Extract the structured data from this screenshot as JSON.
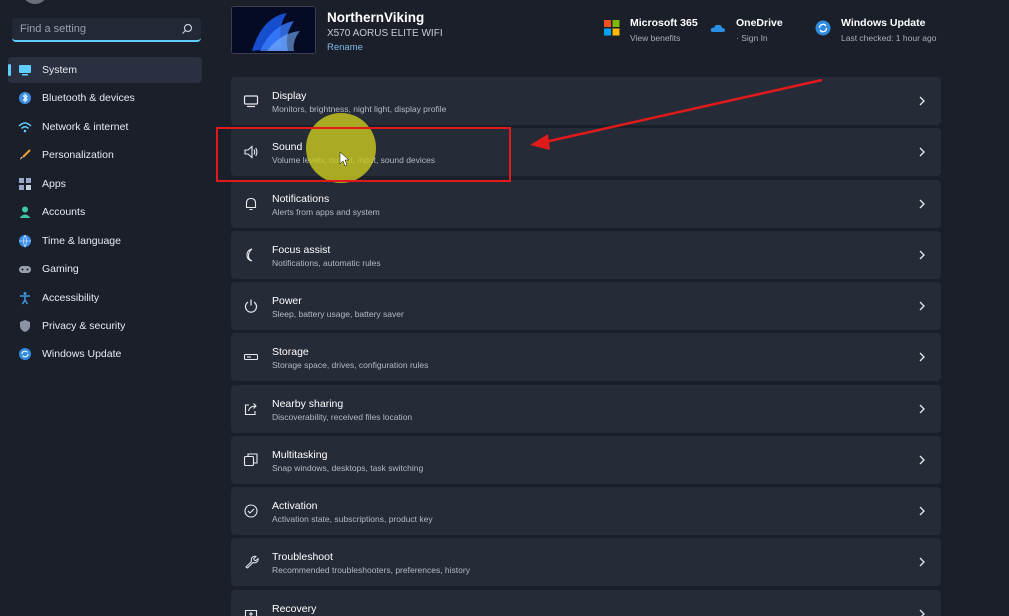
{
  "sidebar": {
    "search_placeholder": "Find a setting",
    "items": [
      {
        "label": "System",
        "icon": "system-icon"
      },
      {
        "label": "Bluetooth & devices",
        "icon": "bluetooth-icon"
      },
      {
        "label": "Network & internet",
        "icon": "network-icon"
      },
      {
        "label": "Personalization",
        "icon": "brush-icon"
      },
      {
        "label": "Apps",
        "icon": "apps-icon"
      },
      {
        "label": "Accounts",
        "icon": "accounts-icon"
      },
      {
        "label": "Time & language",
        "icon": "globe-icon"
      },
      {
        "label": "Gaming",
        "icon": "gaming-icon"
      },
      {
        "label": "Accessibility",
        "icon": "accessibility-icon"
      },
      {
        "label": "Privacy & security",
        "icon": "shield-icon"
      },
      {
        "label": "Windows Update",
        "icon": "update-icon"
      }
    ],
    "active_item": "System"
  },
  "header": {
    "device_name": "NorthernViking",
    "device_model": "X570 AORUS ELITE WIFI",
    "rename_label": "Rename",
    "microsoft365": {
      "title": "Microsoft 365",
      "sub": "View benefits"
    },
    "onedrive": {
      "title": "OneDrive",
      "sub": "· Sign In"
    },
    "windows_update": {
      "title": "Windows Update",
      "sub": "Last checked: 1 hour ago"
    }
  },
  "settings": [
    {
      "title": "Display",
      "sub": "Monitors, brightness, night light, display profile",
      "icon": "display-icon"
    },
    {
      "title": "Sound",
      "sub": "Volume levels, output, input, sound devices",
      "icon": "speaker-icon"
    },
    {
      "title": "Notifications",
      "sub": "Alerts from apps and system",
      "icon": "bell-icon"
    },
    {
      "title": "Focus assist",
      "sub": "Notifications, automatic rules",
      "icon": "moon-icon"
    },
    {
      "title": "Power",
      "sub": "Sleep, battery usage, battery saver",
      "icon": "power-icon"
    },
    {
      "title": "Storage",
      "sub": "Storage space, drives, configuration rules",
      "icon": "storage-icon"
    },
    {
      "title": "Nearby sharing",
      "sub": "Discoverability, received files location",
      "icon": "share-icon"
    },
    {
      "title": "Multitasking",
      "sub": "Snap windows, desktops, task switching",
      "icon": "multitask-icon"
    },
    {
      "title": "Activation",
      "sub": "Activation state, subscriptions, product key",
      "icon": "check-circle-icon"
    },
    {
      "title": "Troubleshoot",
      "sub": "Recommended troubleshooters, preferences, history",
      "icon": "wrench-icon"
    },
    {
      "title": "Recovery",
      "sub": "",
      "icon": "recovery-icon"
    }
  ],
  "colors": {
    "accent": "#60cdff",
    "background": "#1b1f2a",
    "card": "#262b38",
    "annotation_red": "#e01a1a",
    "cursor_highlight": "#c8c81e"
  }
}
